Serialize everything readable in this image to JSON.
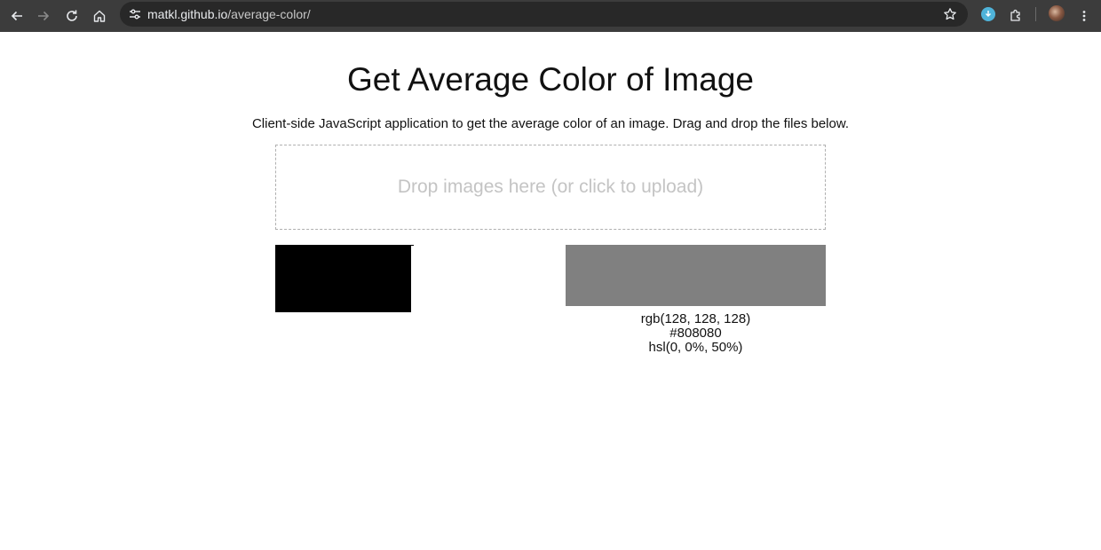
{
  "browser": {
    "url_host": "matkl.github.io",
    "url_path": "/average-color/",
    "icons": {
      "back": "arrow-left-icon",
      "forward": "arrow-right-icon",
      "reload": "reload-icon",
      "home": "home-icon",
      "site_info": "tune-icon",
      "bookmark": "star-icon",
      "extension_download": "download-icon",
      "extensions": "puzzle-icon",
      "menu": "kebab-menu-icon"
    }
  },
  "page": {
    "title": "Get Average Color of Image",
    "description": "Client-side JavaScript application to get the average color of an image. Drag and drop the files below.",
    "dropzone_text": "Drop images here (or click to upload)"
  },
  "result": {
    "swatch_color": "#808080",
    "preview_color": "#000000",
    "rgb": "rgb(128, 128, 128)",
    "hex": "#808080",
    "hsl": "hsl(0, 0%, 50%)"
  }
}
